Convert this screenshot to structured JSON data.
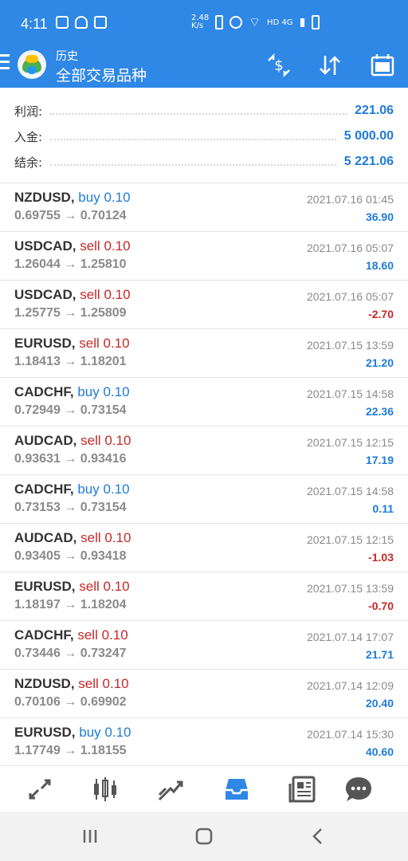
{
  "status_bar": {
    "time": "4:11",
    "net_speed": "2.48 K/s",
    "network": "HD 4G"
  },
  "app_bar": {
    "subtitle": "历史",
    "title": "全部交易品种",
    "icons": [
      "menu-icon",
      "currency-sort-icon",
      "sort-icon",
      "calendar-icon"
    ]
  },
  "summary": {
    "profit_label": "利润:",
    "profit_value": "221.06",
    "deposit_label": "入金:",
    "deposit_value": "5 000.00",
    "balance_label": "结余:",
    "balance_value": "5 221.06"
  },
  "trades": [
    {
      "symbol": "NZDUSD,",
      "side": "buy",
      "volume": "0.10",
      "prices": "0.69755 → 0.70124",
      "time": "2021.07.16 01:45",
      "profit": "36.90"
    },
    {
      "symbol": "USDCAD,",
      "side": "sell",
      "volume": "0.10",
      "prices": "1.26044 → 1.25810",
      "time": "2021.07.16 05:07",
      "profit": "18.60"
    },
    {
      "symbol": "USDCAD,",
      "side": "sell",
      "volume": "0.10",
      "prices": "1.25775 → 1.25809",
      "time": "2021.07.16 05:07",
      "profit": "-2.70"
    },
    {
      "symbol": "EURUSD,",
      "side": "sell",
      "volume": "0.10",
      "prices": "1.18413 → 1.18201",
      "time": "2021.07.15 13:59",
      "profit": "21.20"
    },
    {
      "symbol": "CADCHF,",
      "side": "buy",
      "volume": "0.10",
      "prices": "0.72949 → 0.73154",
      "time": "2021.07.15 14:58",
      "profit": "22.36"
    },
    {
      "symbol": "AUDCAD,",
      "side": "sell",
      "volume": "0.10",
      "prices": "0.93631 → 0.93416",
      "time": "2021.07.15 12:15",
      "profit": "17.19"
    },
    {
      "symbol": "CADCHF,",
      "side": "buy",
      "volume": "0.10",
      "prices": "0.73153 → 0.73154",
      "time": "2021.07.15 14:58",
      "profit": "0.11"
    },
    {
      "symbol": "AUDCAD,",
      "side": "sell",
      "volume": "0.10",
      "prices": "0.93405 → 0.93418",
      "time": "2021.07.15 12:15",
      "profit": "-1.03"
    },
    {
      "symbol": "EURUSD,",
      "side": "sell",
      "volume": "0.10",
      "prices": "1.18197 → 1.18204",
      "time": "2021.07.15 13:59",
      "profit": "-0.70"
    },
    {
      "symbol": "CADCHF,",
      "side": "sell",
      "volume": "0.10",
      "prices": "0.73446 → 0.73247",
      "time": "2021.07.14 17:07",
      "profit": "21.71"
    },
    {
      "symbol": "NZDUSD,",
      "side": "sell",
      "volume": "0.10",
      "prices": "0.70106 → 0.69902",
      "time": "2021.07.14 12:09",
      "profit": "20.40"
    },
    {
      "symbol": "EURUSD,",
      "side": "buy",
      "volume": "0.10",
      "prices": "1.17749 → 1.18155",
      "time": "2021.07.14 15:30",
      "profit": "40.60"
    }
  ],
  "bottom_nav": {
    "items": [
      "quotes-icon",
      "chart-candles-icon",
      "trade-icon",
      "history-inbox-icon",
      "news-icon",
      "chat-icon"
    ],
    "active": "history-inbox-icon"
  },
  "system_nav": [
    "recents-icon",
    "home-icon",
    "back-icon"
  ],
  "colors": {
    "accent": "#2f87e6",
    "buy": "#1e7bd7",
    "sell": "#c62828",
    "muted": "#8a8a8a"
  }
}
